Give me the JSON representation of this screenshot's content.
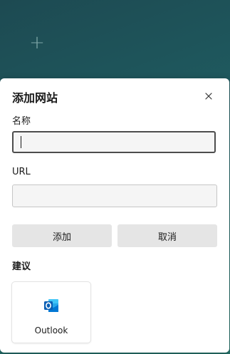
{
  "background": {
    "add_tile_icon": "plus-icon"
  },
  "dialog": {
    "title": "添加网站",
    "close_icon": "close-icon",
    "name_label": "名称",
    "name_value": "",
    "url_label": "URL",
    "url_value": "",
    "add_button": "添加",
    "cancel_button": "取消",
    "suggestions_heading": "建议",
    "suggestions": [
      {
        "label": "Outlook",
        "icon": "outlook-icon"
      }
    ]
  },
  "colors": {
    "accent": "#0078d4",
    "button_bg": "#e5e5e5",
    "input_bg": "#f5f5f5",
    "backdrop": "#1f5a5f"
  }
}
